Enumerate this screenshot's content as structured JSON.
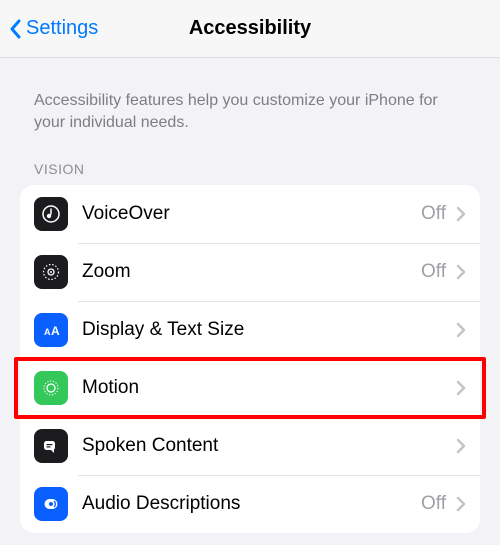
{
  "nav": {
    "back_label": "Settings",
    "title": "Accessibility"
  },
  "description": "Accessibility features help you customize your iPhone for your individual needs.",
  "section": {
    "header_vision": "VISION"
  },
  "rows": {
    "voiceover": {
      "label": "VoiceOver",
      "status": "Off",
      "icon_bg": "#1c1c1e"
    },
    "zoom": {
      "label": "Zoom",
      "status": "Off",
      "icon_bg": "#1c1c1e"
    },
    "display": {
      "label": "Display & Text Size",
      "status": "",
      "icon_bg": "#0a60ff"
    },
    "motion": {
      "label": "Motion",
      "status": "",
      "icon_bg": "#34c759"
    },
    "spoken": {
      "label": "Spoken Content",
      "status": "",
      "icon_bg": "#1c1c1e"
    },
    "audiodesc": {
      "label": "Audio Descriptions",
      "status": "Off",
      "icon_bg": "#0a60ff"
    }
  }
}
